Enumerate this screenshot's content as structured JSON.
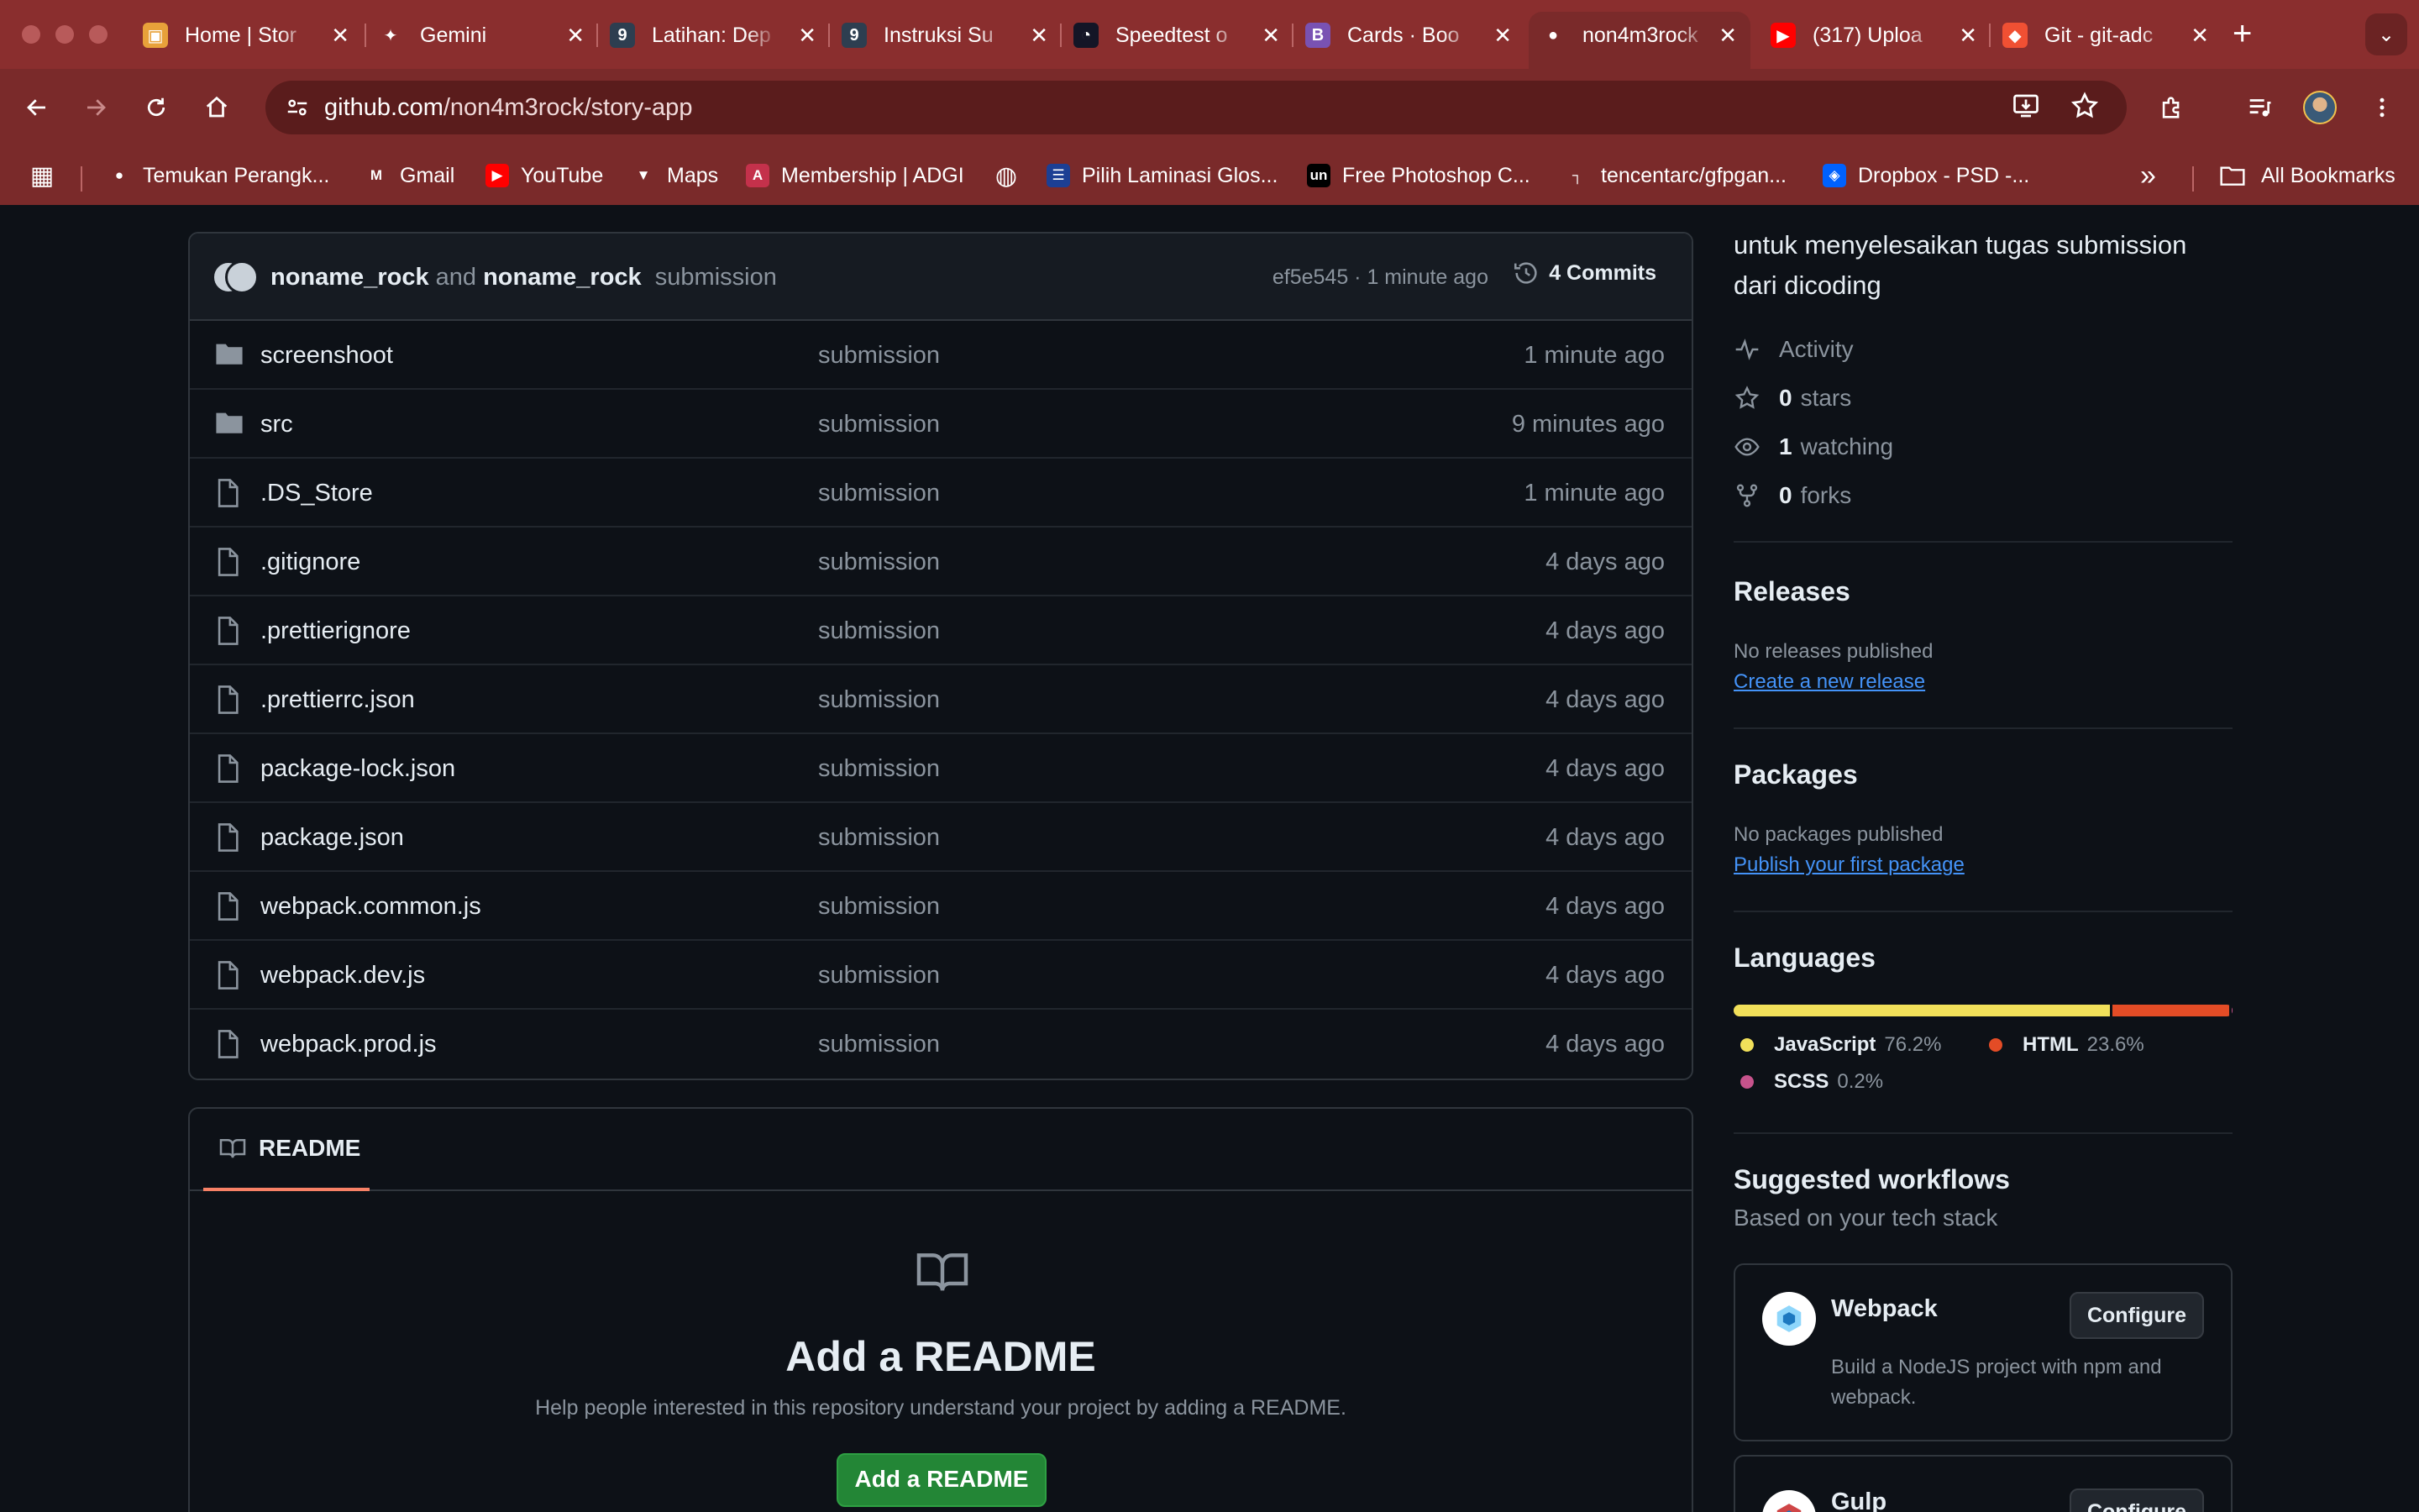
{
  "browser": {
    "tabs": [
      {
        "title": "Home | Stor",
        "favicon": "storybook-icon",
        "color": "#e8a13a",
        "glyph": "▣"
      },
      {
        "title": "Gemini",
        "favicon": "gemini-icon",
        "color": "transparent",
        "glyph": "✦"
      },
      {
        "title": "Latihan: Dep",
        "favicon": "dicoding-icon",
        "color": "#2d3e50",
        "glyph": "9"
      },
      {
        "title": "Instruksi Su",
        "favicon": "dicoding-icon",
        "color": "#2d3e50",
        "glyph": "9"
      },
      {
        "title": "Speedtest o",
        "favicon": "speedtest-icon",
        "color": "#141526",
        "glyph": "◔"
      },
      {
        "title": "Cards · Boo",
        "favicon": "bootstrap-icon",
        "color": "#7952b3",
        "glyph": "B"
      },
      {
        "title": "non4m3rock",
        "favicon": "github-icon",
        "color": "transparent",
        "glyph": "●",
        "active": true
      },
      {
        "title": "(317) Uploa",
        "favicon": "youtube-icon",
        "color": "#ff0000",
        "glyph": "▶"
      },
      {
        "title": "Git - git-adc",
        "favicon": "git-icon",
        "color": "#f05033",
        "glyph": "◆"
      }
    ],
    "tab_close_glyph": "✕",
    "new_tab_glyph": "+",
    "tab_search_glyph": "⌄",
    "url_host": "github.com",
    "url_path": "/non4m3rock/story-app",
    "bookmarks": [
      {
        "label": "",
        "icon": "apps-grid-icon",
        "glyph": "▦",
        "color": "transparent"
      },
      {
        "label": "Temukan Perangk...",
        "icon": "google-icon",
        "glyph": "●",
        "color": "transparent"
      },
      {
        "label": "Gmail",
        "icon": "gmail-icon",
        "glyph": "M",
        "color": "transparent"
      },
      {
        "label": "YouTube",
        "icon": "youtube-icon",
        "glyph": "▶",
        "color": "#ff0000"
      },
      {
        "label": "Maps",
        "icon": "maps-icon",
        "glyph": "▼",
        "color": "transparent"
      },
      {
        "label": "Membership | ADGI",
        "icon": "adgi-icon",
        "glyph": "A",
        "color": "#c4314b"
      },
      {
        "label": "",
        "icon": "globe-icon",
        "glyph": "◍",
        "color": "transparent"
      },
      {
        "label": "Pilih Laminasi Glos...",
        "icon": "site-icon",
        "glyph": "☰",
        "color": "#1c3f94"
      },
      {
        "label": "Free Photoshop C...",
        "icon": "unblast-icon",
        "glyph": "un",
        "color": "#000000"
      },
      {
        "label": "tencentarc/gfpgan...",
        "icon": "replicate-icon",
        "glyph": "┐",
        "color": "transparent"
      },
      {
        "label": "Dropbox - PSD -...",
        "icon": "dropbox-icon",
        "glyph": "◈",
        "color": "#0061fe"
      }
    ],
    "bookmarks_more_glyph": "»",
    "all_bookmarks_label": "All Bookmarks"
  },
  "repo": {
    "commit": {
      "author1": "noname_rock",
      "joiner": "and",
      "author2": "noname_rock",
      "message": "submission",
      "meta": "ef5e545 · 1 minute ago",
      "commits_label": "4 Commits"
    },
    "files": [
      {
        "name": "screenshoot",
        "type": "dir",
        "message": "submission",
        "date": "1 minute ago"
      },
      {
        "name": "src",
        "type": "dir",
        "message": "submission",
        "date": "9 minutes ago"
      },
      {
        "name": ".DS_Store",
        "type": "file",
        "message": "submission",
        "date": "1 minute ago"
      },
      {
        "name": ".gitignore",
        "type": "file",
        "message": "submission",
        "date": "4 days ago"
      },
      {
        "name": ".prettierignore",
        "type": "file",
        "message": "submission",
        "date": "4 days ago"
      },
      {
        "name": ".prettierrc.json",
        "type": "file",
        "message": "submission",
        "date": "4 days ago"
      },
      {
        "name": "package-lock.json",
        "type": "file",
        "message": "submission",
        "date": "4 days ago"
      },
      {
        "name": "package.json",
        "type": "file",
        "message": "submission",
        "date": "4 days ago"
      },
      {
        "name": "webpack.common.js",
        "type": "file",
        "message": "submission",
        "date": "4 days ago"
      },
      {
        "name": "webpack.dev.js",
        "type": "file",
        "message": "submission",
        "date": "4 days ago"
      },
      {
        "name": "webpack.prod.js",
        "type": "file",
        "message": "submission",
        "date": "4 days ago"
      }
    ],
    "readme": {
      "tab_label": "README",
      "title": "Add a README",
      "description": "Help people interested in this repository understand your project by adding a README.",
      "button": "Add a README"
    }
  },
  "sidebar": {
    "about_description": "untuk menyelesaikan tugas submission dari dicoding",
    "activity_label": "Activity",
    "stars_count": "0",
    "stars_label": "stars",
    "watching_count": "1",
    "watching_label": "watching",
    "forks_count": "0",
    "forks_label": "forks",
    "releases_title": "Releases",
    "releases_text": "No releases published",
    "releases_link": "Create a new release",
    "packages_title": "Packages",
    "packages_text": "No packages published",
    "packages_link": "Publish your first package",
    "languages_title": "Languages",
    "languages": [
      {
        "name": "JavaScript",
        "percent": "76.2%",
        "share": 76.2,
        "color": "#f1e05a"
      },
      {
        "name": "HTML",
        "percent": "23.6%",
        "share": 23.6,
        "color": "#e34c26"
      },
      {
        "name": "SCSS",
        "percent": "0.2%",
        "share": 0.2,
        "color": "#c6538c"
      }
    ],
    "workflows_title": "Suggested workflows",
    "workflows_subtitle": "Based on your tech stack",
    "workflows": [
      {
        "name": "Webpack",
        "description": "Build a NodeJS project with npm and webpack.",
        "button": "Configure",
        "logo_color": "#8ed6fb"
      },
      {
        "name": "Gulp",
        "description": "",
        "button": "Configure",
        "logo_color": "#cf4647"
      }
    ]
  }
}
